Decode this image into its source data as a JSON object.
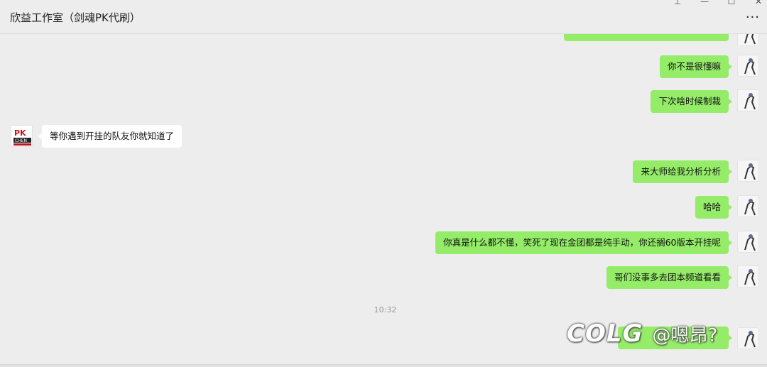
{
  "window": {
    "title": "欣益工作室（剑魂PK代刷）",
    "controls": {
      "pin": "⊥",
      "minimize": "—",
      "maximize": "☐",
      "close": "✕"
    },
    "more_label": "···"
  },
  "messages": [
    {
      "side": "out",
      "text": "你不是很懂嘛"
    },
    {
      "side": "out",
      "text": "下次啥时候制裁"
    },
    {
      "side": "in",
      "text": "等你遇到开挂的队友你就知道了"
    },
    {
      "side": "out",
      "text": "来大师给我分析分析"
    },
    {
      "side": "out",
      "text": "哈哈"
    },
    {
      "side": "out",
      "text": "你真是什么都不懂，笑死了现在金团都是纯手动，你还搁60版本开挂呢"
    },
    {
      "side": "out",
      "text": "哥们没事多去团本频道看看"
    }
  ],
  "timestamp": "10:32",
  "watermark": {
    "logo": "COLG",
    "user": "@嗯昂?"
  },
  "peer_avatar": {
    "label": "PK",
    "sub": "CHEN"
  },
  "colors": {
    "bubble_out": "#95ec69",
    "bubble_in": "#ffffff",
    "background": "#ededed"
  }
}
